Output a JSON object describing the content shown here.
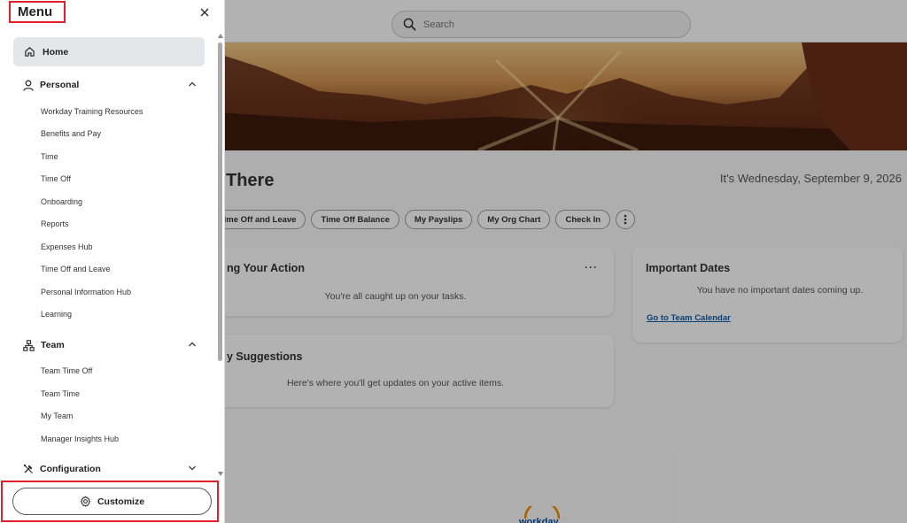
{
  "search": {
    "placeholder": "Search"
  },
  "page": {
    "greeting": "There",
    "date": "It's Wednesday, September 9, 2026",
    "chips": [
      "Time Off and Leave",
      "Time Off Balance",
      "My Payslips",
      "My Org Chart",
      "Check In"
    ],
    "cards": {
      "action": {
        "title": "ng Your Action",
        "text": "You're all caught up on your tasks."
      },
      "suggestions": {
        "title": "y Suggestions",
        "text": "Here's where you'll get updates on your active items."
      },
      "dates": {
        "title": "Important Dates",
        "text": "You have no important dates coming up.",
        "link": "Go to Team Calendar"
      }
    },
    "logo": "workday"
  },
  "menu": {
    "title": "Menu",
    "home": "Home",
    "personal": {
      "label": "Personal",
      "items": [
        "Workday Training Resources",
        "Benefits and Pay",
        "Time",
        "Time Off",
        "Onboarding",
        "Reports",
        "Expenses Hub",
        "Time Off and Leave",
        "Personal Information Hub",
        "Learning"
      ]
    },
    "team": {
      "label": "Team",
      "items": [
        "Team Time Off",
        "Team Time",
        "My Team",
        "Manager Insights Hub"
      ]
    },
    "configuration": {
      "label": "Configuration"
    },
    "customize": "Customize"
  },
  "colors": {
    "highlight_border": "#e0202a",
    "home_bg": "#e4e7ea",
    "link": "#0d5ea8"
  }
}
